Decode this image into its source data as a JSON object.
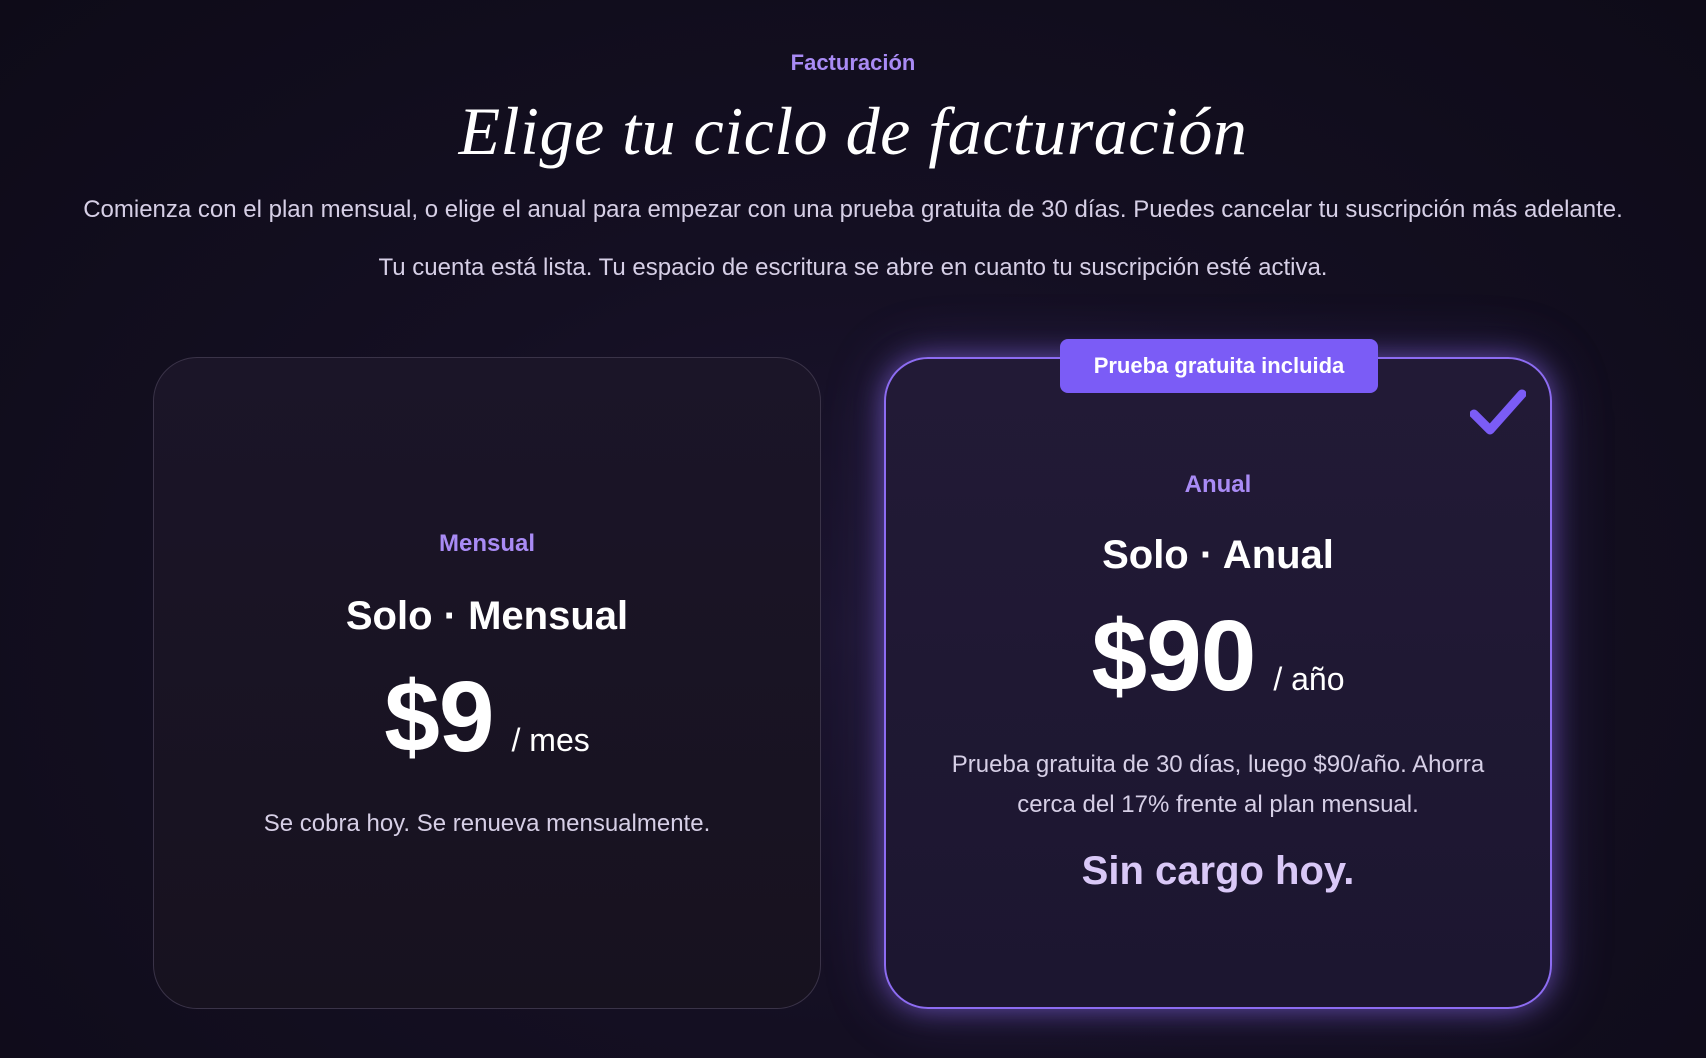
{
  "header": {
    "eyebrow": "Facturación",
    "title": "Elige tu ciclo de facturación",
    "subtitle": "Comienza con el plan mensual, o elige el anual para empezar con una prueba gratuita de 30 días. Puedes cancelar tu suscripción más adelante.",
    "status": "Tu cuenta está lista. Tu espacio de escritura se abre en cuanto tu suscripción esté activa."
  },
  "plans": {
    "monthly": {
      "tag": "Mensual",
      "name": "Solo · Mensual",
      "price": "$9",
      "period": "/ mes",
      "note": "Se cobra hoy. Se renueva mensualmente."
    },
    "annual": {
      "badge": "Prueba gratuita incluida",
      "tag": "Anual",
      "name": "Solo · Anual",
      "price": "$90",
      "period": "/ año",
      "note": "Prueba gratuita de 30 días, luego $90/año. Ahorra cerca del 17% frente al plan mensual.",
      "highlight": "Sin cargo hoy.",
      "selected": true,
      "selected_icon": "checkmark-icon"
    }
  },
  "colors": {
    "accent": "#7b5cf6",
    "accent_text": "#a98bf5",
    "background": "#140f22"
  }
}
